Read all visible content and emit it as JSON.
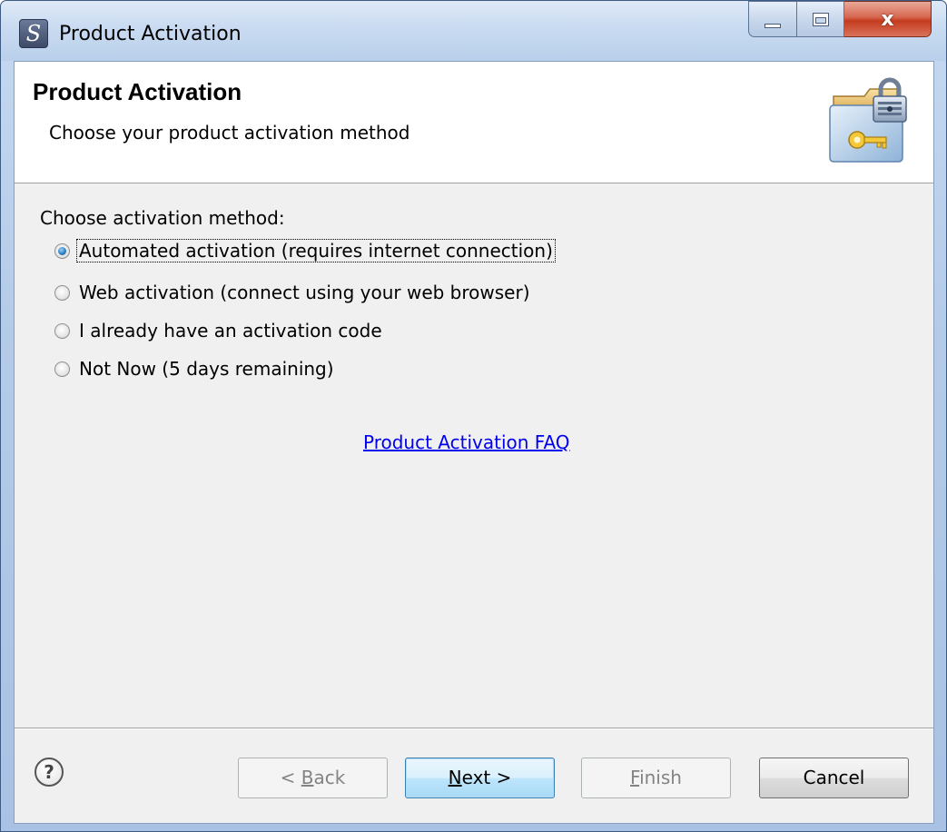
{
  "window": {
    "title": "Product Activation",
    "app_icon_glyph": "S",
    "close_glyph": "x"
  },
  "banner": {
    "title": "Product Activation",
    "subtitle": "Choose your product activation method",
    "icon": "locked-folder-key-icon"
  },
  "activation": {
    "group_label": "Choose activation method:",
    "options": [
      {
        "label": "Automated activation (requires internet connection)",
        "checked": true
      },
      {
        "label": "Web activation (connect using your web browser)",
        "checked": false
      },
      {
        "label": "I already have an activation code",
        "checked": false
      },
      {
        "label": "Not Now (5 days remaining)",
        "checked": false
      }
    ]
  },
  "faq_link": "Product Activation FAQ",
  "footer": {
    "help_glyph": "?",
    "back": {
      "prefix": "< ",
      "mnemonic": "B",
      "rest": "ack",
      "enabled": false
    },
    "next": {
      "mnemonic": "N",
      "rest": "ext >",
      "enabled": true
    },
    "finish": {
      "mnemonic": "F",
      "rest": "inish",
      "enabled": false
    },
    "cancel": {
      "label": "Cancel",
      "enabled": true
    }
  },
  "colors": {
    "link": "#0000ee",
    "radio_selected": "#2d7fc2",
    "close_button": "#c43b1f",
    "default_button": "#bee6fd"
  }
}
